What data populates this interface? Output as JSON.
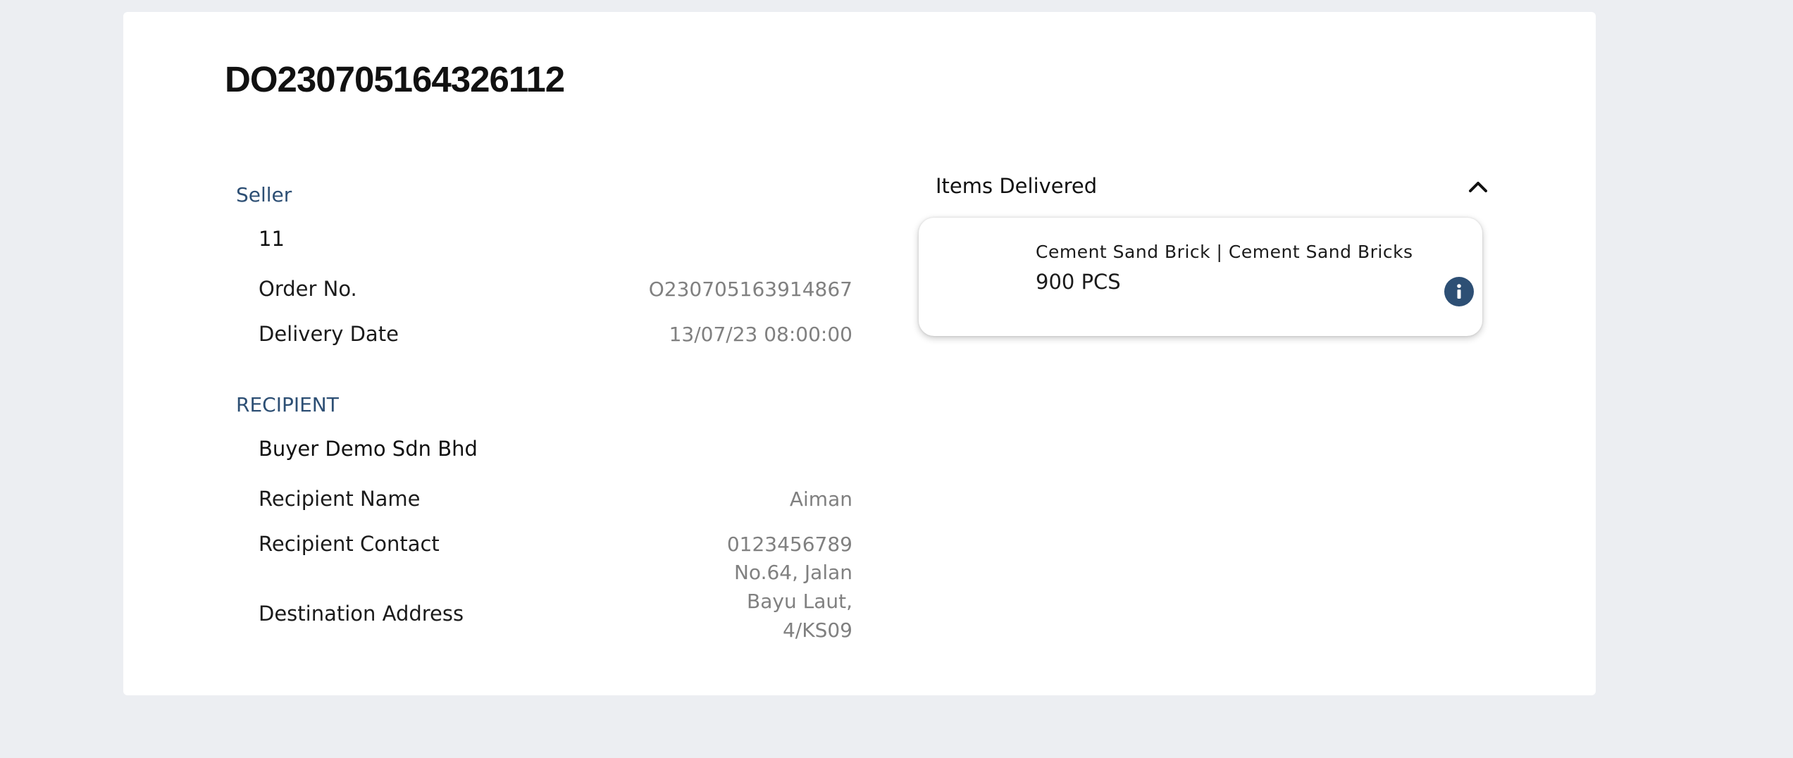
{
  "delivery_order": {
    "number": "DO230705164326112"
  },
  "seller": {
    "section_label": "Seller",
    "name": "11",
    "order_no_label": "Order No.",
    "order_no_value": "O230705163914867",
    "delivery_date_label": "Delivery Date",
    "delivery_date_value": "13/07/23 08:00:00"
  },
  "recipient": {
    "section_label": "RECIPIENT",
    "company": "Buyer Demo Sdn Bhd",
    "name_label": "Recipient Name",
    "name_value": "Aiman",
    "contact_label": "Recipient Contact",
    "contact_value": "0123456789",
    "address_label": "Destination Address",
    "address_value": "No.64, Jalan\nBayu Laut,\n4/KS09"
  },
  "items_delivered": {
    "title": "Items Delivered",
    "toggle_icon": "chevron-up-icon",
    "items": [
      {
        "name": "Cement Sand Brick | Cement Sand Bricks",
        "quantity": "900 PCS",
        "info_icon": "info-icon"
      }
    ]
  },
  "colors": {
    "background": "#eceef2",
    "card": "#ffffff",
    "accent": "#2d4f74",
    "muted_text": "#808080",
    "primary_text": "#111111"
  }
}
